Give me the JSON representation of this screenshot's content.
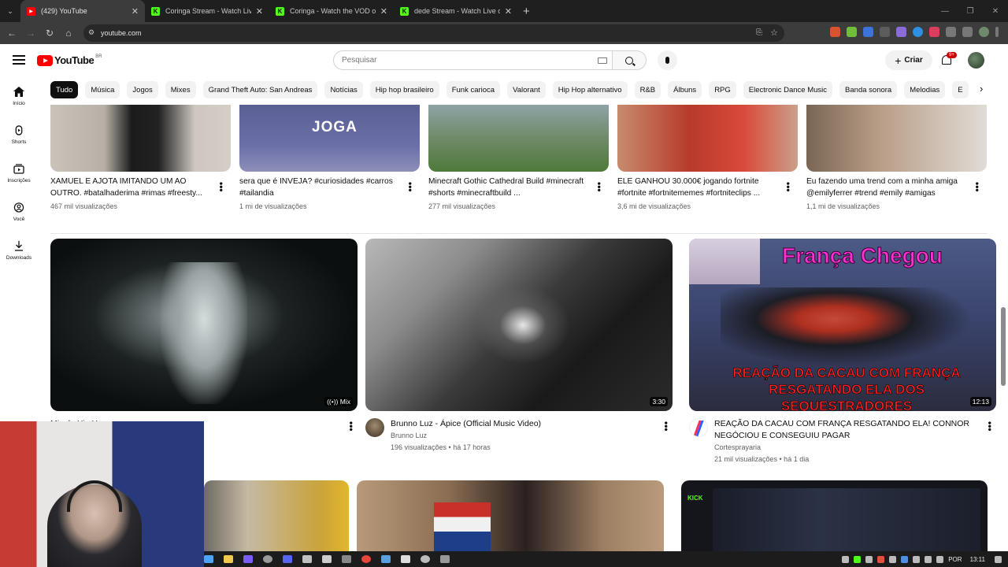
{
  "browser": {
    "tabs": [
      {
        "title": "(429) YouTube",
        "favicon_color": "#ff0000",
        "favicon": "▶",
        "active": true
      },
      {
        "title": "Coringa Stream - Watch Live on K",
        "favicon_color": "#53fc18",
        "favicon": "K",
        "active": false
      },
      {
        "title": "Coringa - Watch the VOD on Ki",
        "favicon_color": "#53fc18",
        "favicon": "K",
        "active": false
      },
      {
        "title": "dede Stream - Watch Live on Ki",
        "favicon_color": "#53fc18",
        "favicon": "K",
        "active": false
      }
    ],
    "url": "youtube.com"
  },
  "header": {
    "logo_text": "YouTube",
    "country_code": "BR",
    "search_placeholder": "Pesquisar",
    "create_label": "Criar",
    "notification_count": "9+"
  },
  "sidebar": [
    {
      "label": "Início",
      "icon": "home-icon"
    },
    {
      "label": "Shorts",
      "icon": "shorts-icon"
    },
    {
      "label": "Inscrições",
      "icon": "subscriptions-icon"
    },
    {
      "label": "Você",
      "icon": "you-icon"
    },
    {
      "label": "Downloads",
      "icon": "download-icon"
    }
  ],
  "chips": [
    "Tudo",
    "Música",
    "Jogos",
    "Mixes",
    "Grand Theft Auto: San Andreas",
    "Notícias",
    "Hip hop brasileiro",
    "Funk carioca",
    "Valorant",
    "Hip Hop alternativo",
    "R&B",
    "Álbuns",
    "RPG",
    "Electronic Dance Music",
    "Banda sonora",
    "Melodias",
    "E"
  ],
  "shorts": [
    {
      "title": "XAMUEL E AJOTA IMITANDO UM AO OUTRO. #batalhaderima #rimas #freesty...",
      "views": "467 mil visualizações"
    },
    {
      "title": "sera que é INVEJA? #curiosidades #carros  #tailandia",
      "views": "1 mi de visualizações",
      "overlay": "JOGA"
    },
    {
      "title": "Minecraft Gothic Cathedral Build #minecraft #shorts #minecraftbuild ...",
      "views": "277 mil visualizações"
    },
    {
      "title": "ELE GANHOU 30.000€ jogando fortnite #fortnite #fortnitememes #fortniteclips ...",
      "views": "3,6 mi de visualizações"
    },
    {
      "title": "Eu fazendo uma trend com a minha amiga @emilyferrer #trend #emily #amigas",
      "views": "1,1 mi de visualizações"
    }
  ],
  "videos": [
    {
      "title": "Mix de Hip Hop",
      "badge": "Mix",
      "channel": "",
      "meta": ""
    },
    {
      "title": "Brunno Luz - Ápice (Official Music Video)",
      "duration": "3:30",
      "channel": "Brunno Luz",
      "meta": "196 visualizações • há 17 horas"
    },
    {
      "title": "REAÇÃO DA CACAU COM FRANÇA RESGATANDO ELA! CONNOR NEGÓCIOU E CONSEGUIU PAGAR",
      "duration": "12:13",
      "channel": "Cortesprayaria",
      "meta": "21 mil visualizações • há 1 dia",
      "overlay_top": "França Chegou",
      "overlay_bottom": "REAÇÃO DA CACAU COM FRANÇA RESGATANDO ELA DOS SEQUESTRADORES"
    }
  ],
  "taskbar": {
    "language": "POR",
    "time": "13:11"
  }
}
